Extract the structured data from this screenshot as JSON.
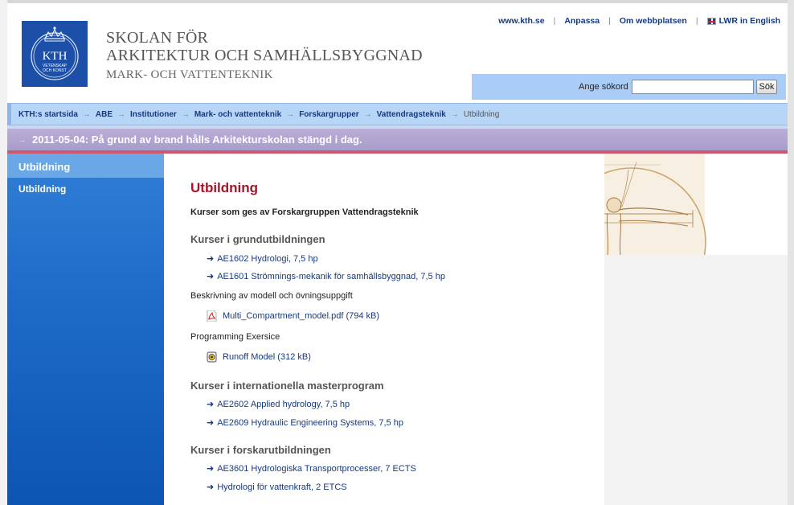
{
  "header": {
    "logo_text": "KTH",
    "logo_subtext_1": "VETENSKAP",
    "logo_subtext_2": "OCH KONST",
    "school_line1": "SKOLAN FÖR",
    "school_line2": "ARKITEKTUR OCH SAMHÄLLSBYGGNAD",
    "school_line3": "MARK- OCH VATTENTEKNIK"
  },
  "toplinks": {
    "home": "www.kth.se",
    "customize": "Anpassa",
    "about": "Om webbplatsen",
    "english": "LWR in English"
  },
  "search": {
    "label": "Ange sökord",
    "value": "",
    "button": "Sök"
  },
  "breadcrumb": {
    "items": [
      "KTH:s startsida",
      "ABE",
      "Institutioner",
      "Mark- och vattenteknik",
      "Forskargrupper",
      "Vattendragsteknik"
    ],
    "current": "Utbildning"
  },
  "notice": {
    "text": "2011-05-04: På grund av brand hålls Arkitekturskolan stängd i dag."
  },
  "sidebar": {
    "header": "Utbildning",
    "items": [
      "Utbildning"
    ]
  },
  "main": {
    "title": "Utbildning",
    "intro": "Kurser som ges av Forskargruppen Vattendragsteknik",
    "section1": {
      "heading": "Kurser i grundutbildningen",
      "links": [
        "AE1602 Hydrologi, 7,5 hp",
        "AE1601 Strömnings-mekanik för samhällsbyggnad, 7,5 hp"
      ]
    },
    "desc_model": "Beskrivning av modell och övningsuppgift",
    "pdf_link": "Multi_Compartment_model.pdf",
    "pdf_size": "(794 kB)",
    "prog_label": "Programming Exersice",
    "runoff_link": "Runoff Model",
    "runoff_size": "(312 kB)",
    "section2": {
      "heading": "Kurser i internationella masterprogram",
      "links": [
        "AE2602 Applied hydrology, 7,5 hp",
        "AE2609 Hydraulic Engineering Systems, 7,5 hp"
      ]
    },
    "section3": {
      "heading": "Kurser i forskarutbildningen",
      "links": [
        "AE3601 Hydrologiska Transportprocesser, 7 ECTS",
        "Hydrologi för vattenkraft, 2 ETCS"
      ]
    }
  },
  "colors": {
    "kth_blue": "#1b4fa8",
    "title_red": "#a5142a",
    "link_blue": "#16397e",
    "notice_purple": "#a99ccc",
    "sidebar_blue": "#1e6cc8"
  }
}
